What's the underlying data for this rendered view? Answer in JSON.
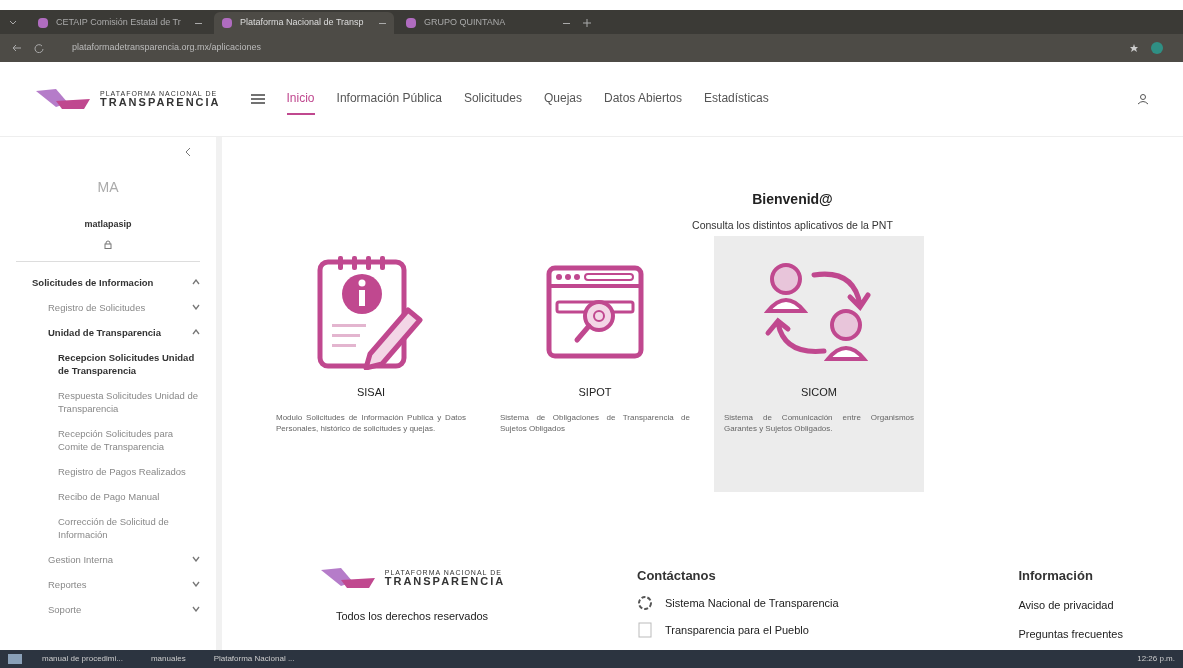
{
  "browser": {
    "tabs": [
      {
        "title": "CETAIP Comisión Estatal de Tr",
        "selected": false
      },
      {
        "title": "Plataforma Nacional de Transp",
        "selected": true
      },
      {
        "title": "GRUPO QUINTANA",
        "selected": false
      }
    ],
    "url": "plataformadetransparencia.org.mx/aplicaciones"
  },
  "header": {
    "logo": {
      "top": "PLATAFORMA NACIONAL DE",
      "bottom": "TRANSPARENCIA"
    },
    "nav": [
      {
        "label": "Inicio",
        "selected": true
      },
      {
        "label": "Información Pública",
        "selected": false
      },
      {
        "label": "Solicitudes",
        "selected": false
      },
      {
        "label": "Quejas",
        "selected": false
      },
      {
        "label": "Datos Abiertos",
        "selected": false
      },
      {
        "label": "Estadísticas",
        "selected": false
      }
    ]
  },
  "sidebar": {
    "initials": "MA",
    "username": "matlapasip",
    "items": [
      {
        "label": "Solicitudes de Informacion",
        "expanded": true,
        "children": [
          {
            "label": "Registro de Solicitudes",
            "expanded": false
          },
          {
            "label": "Unidad de Transparencia",
            "expanded": true,
            "children": [
              {
                "label": "Recepcion Solicitudes Unidad de Transparencia",
                "selected": true
              },
              {
                "label": "Respuesta Solicitudes Unidad de Transparencia",
                "selected": false
              },
              {
                "label": "Recepción Solicitudes para Comite de Transparencia",
                "selected": false
              },
              {
                "label": "Registro de Pagos Realizados",
                "selected": false
              },
              {
                "label": "Recibo de Pago Manual",
                "selected": false
              },
              {
                "label": "Corrección de Solicitud de Información",
                "selected": false
              }
            ]
          },
          {
            "label": "Gestion Interna",
            "expanded": false
          },
          {
            "label": "Reportes",
            "expanded": false
          },
          {
            "label": "Soporte",
            "expanded": false
          }
        ]
      }
    ]
  },
  "main": {
    "title": "Bienvenid@",
    "subtitle": "Consulta los distintos aplicativos de la PNT",
    "apps": [
      {
        "kind": "notepad",
        "name": "SISAI",
        "description": "Modulo Solicitudes de Información Publica y Datos Personales, histórico de solicitudes y quejas.",
        "selected": false
      },
      {
        "kind": "browser",
        "name": "SIPOT",
        "description": "Sistema de Obligaciones de Transparencia de Sujetos Obligados",
        "selected": false
      },
      {
        "kind": "exchange",
        "name": "SICOM",
        "description": "Sistema de Comunicación entre Organismos Garantes y Sujetos Obligados.",
        "selected": true
      }
    ]
  },
  "footer": {
    "logo": {
      "top": "PLATAFORMA NACIONAL DE",
      "bottom": "TRANSPARENCIA"
    },
    "rights": "Todos los derechos reservados",
    "contact_title": "Contáctanos",
    "contacts": [
      "Sistema Nacional de Transparencia",
      "Transparencia para el Pueblo"
    ],
    "info_title": "Información",
    "info_links": [
      "Aviso de privacidad",
      "Preguntas frecuentes"
    ]
  },
  "taskbar": {
    "items": [
      "manual de procedimi...",
      "manuales",
      "Plataforma Nacional ..."
    ],
    "time": "12:26 p.m."
  }
}
